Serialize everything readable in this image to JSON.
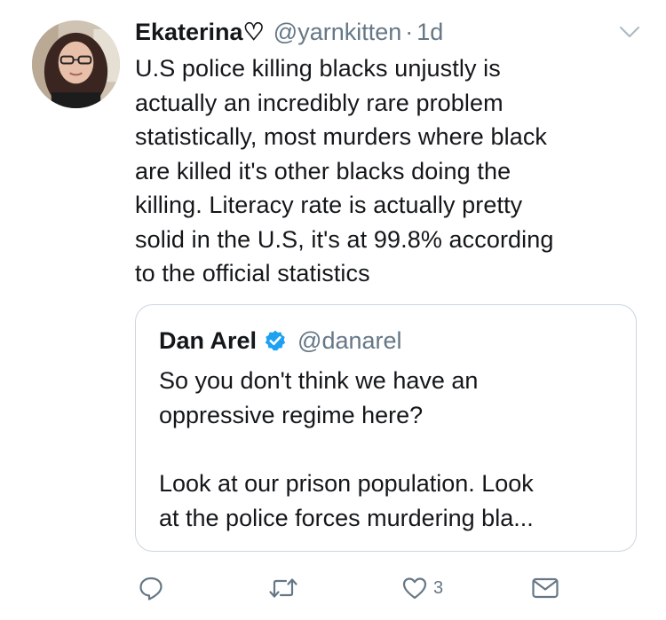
{
  "tweet": {
    "author_name": "Ekaterina♡",
    "author_handle": "@yarnkitten",
    "separator": "·",
    "time": "1d",
    "text": "U.S police killing blacks unjustly is\nactually an incredibly rare problem\nstatistically, most murders where black\nare killed it's other blacks doing the\nkilling. Literacy rate is actually pretty\nsolid in the U.S, it's at 99.8% according\nto the official statistics"
  },
  "quoted_tweet": {
    "author_name": "Dan Arel",
    "author_handle": "@danarel",
    "text": "So you don't think we have an\noppressive regime here?\n\nLook at our prison population. Look\nat the police forces murdering bla..."
  },
  "actions": {
    "like_count": "3"
  },
  "icons": {
    "avatar": "profile-photo",
    "chevron": "chevron-down-icon",
    "verified": "verified-badge-icon",
    "reply": "reply-icon",
    "retweet": "retweet-icon",
    "like": "heart-icon",
    "dm": "envelope-icon"
  },
  "colors": {
    "text": "#14171a",
    "muted": "#657786",
    "verified": "#1da1f2",
    "border": "#ccd6dd"
  }
}
